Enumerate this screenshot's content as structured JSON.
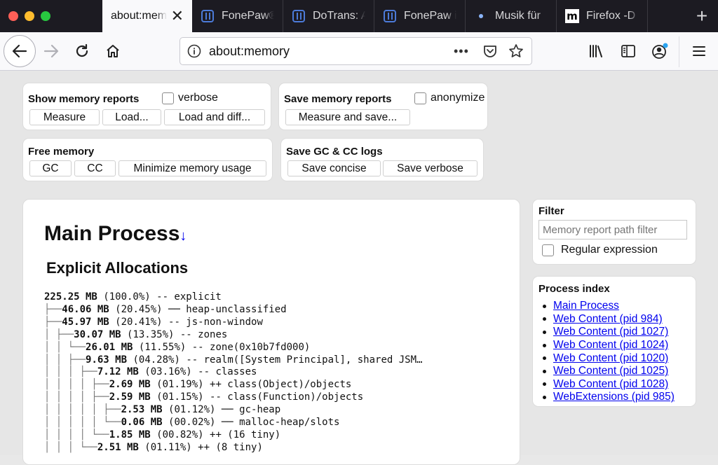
{
  "tabs": [
    {
      "title": "about:memory",
      "icon": "none",
      "active": true
    },
    {
      "title": "FonePaw®",
      "icon": "fonepaw-icon"
    },
    {
      "title": "DoTrans: A",
      "icon": "fonepaw-icon"
    },
    {
      "title": "FonePaw i",
      "icon": "fonepaw-icon"
    },
    {
      "title": "Musik für",
      "icon": "dot-icon"
    },
    {
      "title": "Firefox -D",
      "icon": "mdn-icon"
    }
  ],
  "tab_icons": {
    "mdn": "m"
  },
  "url": {
    "text": "about:memory",
    "dots": "•••"
  },
  "show_reports": {
    "title": "Show memory reports",
    "verbose_label": "verbose",
    "measure": "Measure",
    "load": "Load...",
    "load_diff": "Load and diff..."
  },
  "save_reports": {
    "title": "Save memory reports",
    "anonymize_label": "anonymize",
    "measure_save": "Measure and save..."
  },
  "free_memory": {
    "title": "Free memory",
    "gc": "GC",
    "cc": "CC",
    "minimize": "Minimize memory usage"
  },
  "gc_logs": {
    "title": "Save GC & CC logs",
    "concise": "Save concise",
    "verbose": "Save verbose"
  },
  "main": {
    "process_title": "Main Process",
    "arrow": "↓",
    "section_title": "Explicit Allocations",
    "tree": [
      {
        "prefix": "",
        "size": "225.25 MB",
        "rest": " (100.0%) -- explicit"
      },
      {
        "prefix": "├──",
        "size": "46.06 MB",
        "rest": " (20.45%) ── heap-unclassified"
      },
      {
        "prefix": "├──",
        "size": "45.97 MB",
        "rest": " (20.41%) -- js-non-window"
      },
      {
        "prefix": "│  ├──",
        "size": "30.07 MB",
        "rest": " (13.35%) -- zones"
      },
      {
        "prefix": "│  │  └──",
        "size": "26.01 MB",
        "rest": " (11.55%) -- zone(0x10b7fd000)"
      },
      {
        "prefix": "│  │     ├──",
        "size": "9.63 MB",
        "rest": " (04.28%) -- realm([System Principal], shared JSM…"
      },
      {
        "prefix": "│  │     │  ├──",
        "size": "7.12 MB",
        "rest": " (03.16%) -- classes"
      },
      {
        "prefix": "│  │     │  │  ├──",
        "size": "2.69 MB",
        "rest": " (01.19%) ++ class(Object)/objects"
      },
      {
        "prefix": "│  │     │  │  ├──",
        "size": "2.59 MB",
        "rest": " (01.15%) -- class(Function)/objects"
      },
      {
        "prefix": "│  │     │  │  │  ├──",
        "size": "2.53 MB",
        "rest": " (01.12%) ── gc-heap"
      },
      {
        "prefix": "│  │     │  │  │  └──",
        "size": "0.06 MB",
        "rest": " (00.02%) ── malloc-heap/slots"
      },
      {
        "prefix": "│  │     │  │  └──",
        "size": "1.85 MB",
        "rest": " (00.82%) ++ (16 tiny)"
      },
      {
        "prefix": "│  │     │  └──",
        "size": "2.51 MB",
        "rest": " (01.11%) ++ (8 tiny)"
      }
    ]
  },
  "filter": {
    "title": "Filter",
    "placeholder": "Memory report path filter",
    "regex_label": "Regular expression"
  },
  "process_index": {
    "title": "Process index",
    "items": [
      "Main Process",
      "Web Content (pid 984)",
      "Web Content (pid 1027)",
      "Web Content (pid 1024)",
      "Web Content (pid 1020)",
      "Web Content (pid 1025)",
      "Web Content (pid 1028)",
      "WebExtensions (pid 985)"
    ]
  }
}
